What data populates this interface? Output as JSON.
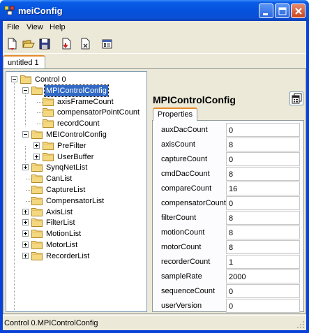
{
  "window": {
    "title": "meiConfig",
    "buttons": {
      "minimize": "minimize",
      "maximize": "maximize",
      "close": "close"
    }
  },
  "menu": [
    {
      "label": "File"
    },
    {
      "label": "View"
    },
    {
      "label": "Help"
    }
  ],
  "toolbar": {
    "tools": [
      "new-icon",
      "open-folder-icon",
      "save-icon",
      "download-icon",
      "delete-icon",
      "properties-icon"
    ]
  },
  "document_tab": {
    "label": "untitled 1"
  },
  "tree": {
    "root": "Control 0",
    "selected": "MPIControlConfig",
    "items": [
      {
        "label": "Control 0",
        "level": 0,
        "expander": "minus"
      },
      {
        "label": "MPIControlConfig",
        "level": 1,
        "expander": "minus"
      },
      {
        "label": "axisFrameCount",
        "level": 2,
        "expander": ""
      },
      {
        "label": "compensatorPointCount",
        "level": 2,
        "expander": ""
      },
      {
        "label": "recordCount",
        "level": 2,
        "expander": ""
      },
      {
        "label": "MEIControlConfig",
        "level": 1,
        "expander": "minus"
      },
      {
        "label": "PreFilter",
        "level": 2,
        "expander": "plus"
      },
      {
        "label": "UserBuffer",
        "level": 2,
        "expander": "plus"
      },
      {
        "label": "SynqNetList",
        "level": 1,
        "expander": "plus"
      },
      {
        "label": "CanList",
        "level": 1,
        "expander": ""
      },
      {
        "label": "CaptureList",
        "level": 1,
        "expander": ""
      },
      {
        "label": "CompensatorList",
        "level": 1,
        "expander": ""
      },
      {
        "label": "AxisList",
        "level": 1,
        "expander": "plus"
      },
      {
        "label": "FilterList",
        "level": 1,
        "expander": "plus"
      },
      {
        "label": "MotionList",
        "level": 1,
        "expander": "plus"
      },
      {
        "label": "MotorList",
        "level": 1,
        "expander": "plus"
      },
      {
        "label": "RecorderList",
        "level": 1,
        "expander": "plus"
      }
    ]
  },
  "properties": {
    "title": "MPIControlConfig",
    "tab": "Properties",
    "rows": [
      {
        "name": "auxDacCount",
        "value": "0"
      },
      {
        "name": "axisCount",
        "value": "8"
      },
      {
        "name": "captureCount",
        "value": "0"
      },
      {
        "name": "cmdDacCount",
        "value": "8"
      },
      {
        "name": "compareCount",
        "value": "16"
      },
      {
        "name": "compensatorCount",
        "value": "0"
      },
      {
        "name": "filterCount",
        "value": "8"
      },
      {
        "name": "motionCount",
        "value": "8"
      },
      {
        "name": "motorCount",
        "value": "8"
      },
      {
        "name": "recorderCount",
        "value": "1"
      },
      {
        "name": "sampleRate",
        "value": "2000"
      },
      {
        "name": "sequenceCount",
        "value": "0"
      },
      {
        "name": "userVersion",
        "value": "0"
      }
    ]
  },
  "status": {
    "text": "Control 0.MPIControlConfig"
  },
  "colors": {
    "title_bar": "#0553dd",
    "selection": "#316ac5",
    "tab_accent": "#e68b2c",
    "face": "#ece9d8"
  }
}
